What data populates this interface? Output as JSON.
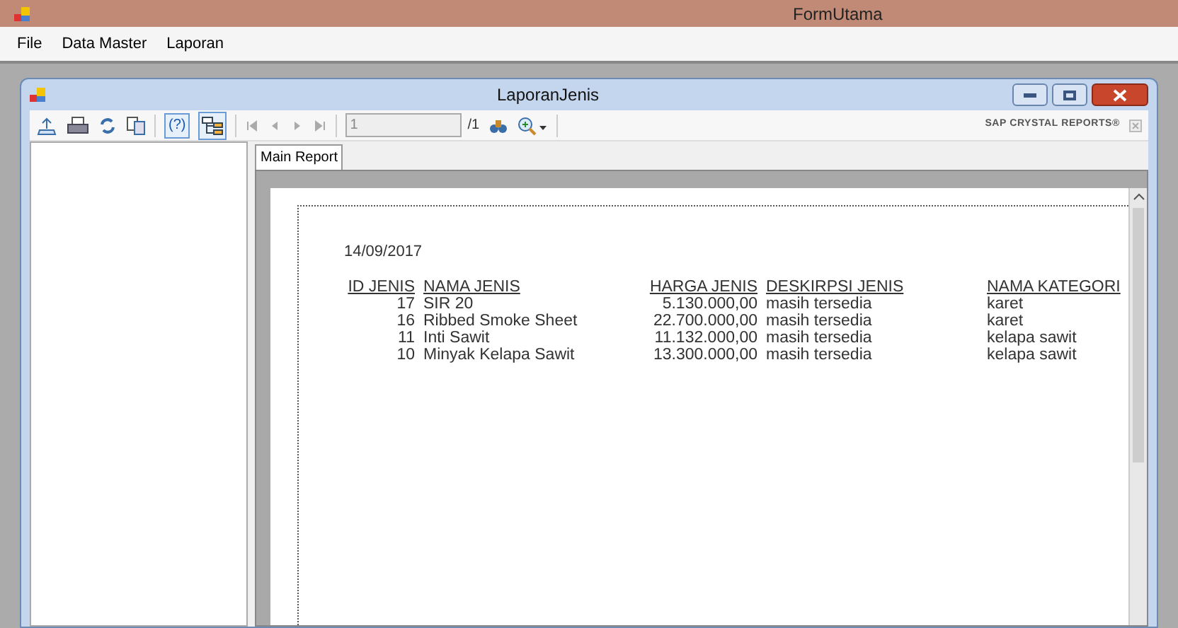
{
  "window": {
    "title": "FormUtama"
  },
  "menu": [
    {
      "label": "File"
    },
    {
      "label": "Data Master"
    },
    {
      "label": "Laporan"
    }
  ],
  "child_window": {
    "title": "LaporanJenis"
  },
  "toolbar": {
    "help_label": "(?)",
    "group_tree_selected": true,
    "page_value": "1",
    "page_total": "/1",
    "brand": "SAP CRYSTAL REPORTS®"
  },
  "tabs": [
    {
      "label": "Main Report",
      "selected": true
    }
  ],
  "report": {
    "date": "14/09/2017",
    "columns": [
      "ID JENIS",
      "NAMA JENIS",
      "HARGA JENIS",
      "DESKIRPSI JENIS",
      "NAMA KATEGORI"
    ],
    "rows": [
      [
        "17",
        "SIR 20",
        "5.130.000,00",
        "masih tersedia",
        "karet"
      ],
      [
        "16",
        "Ribbed Smoke Sheet",
        "22.700.000,00",
        "masih tersedia",
        "karet"
      ],
      [
        "11",
        "Inti Sawit",
        "11.132.000,00",
        "masih tersedia",
        "kelapa sawit"
      ],
      [
        "10",
        "Minyak Kelapa Sawit",
        "13.300.000,00",
        "masih tersedia",
        "kelapa sawit"
      ]
    ]
  }
}
